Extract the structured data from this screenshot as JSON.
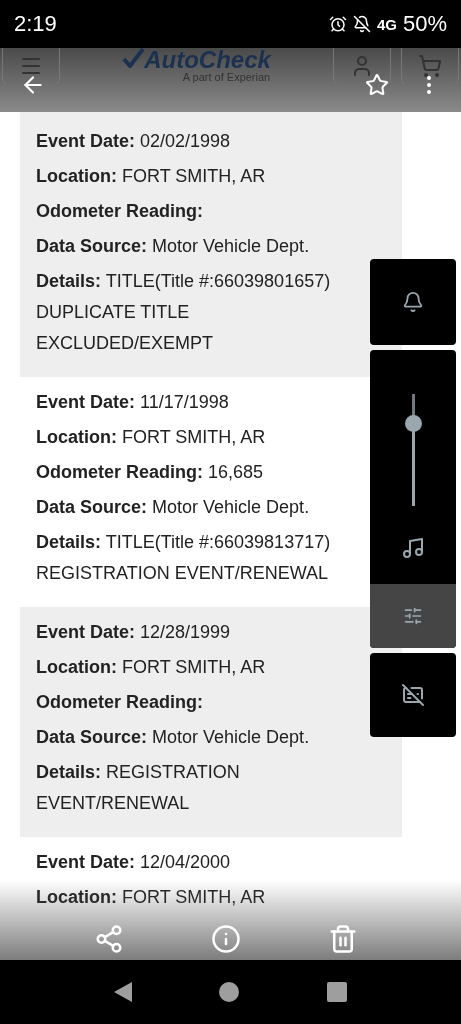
{
  "status_bar": {
    "time": "2:19",
    "network": "4G",
    "battery": "50%"
  },
  "site_header": {
    "brand": "AutoCheck",
    "tagline": "A part of Experian"
  },
  "records": [
    {
      "fields": [
        {
          "label": "Event Date:",
          "value": "02/02/1998"
        },
        {
          "label": "Location:",
          "value": "FORT SMITH, AR"
        },
        {
          "label": "Odometer Reading:"
        },
        {
          "label": "Data Source:",
          "value": "Motor Vehicle Dept."
        },
        {
          "label": "Details:",
          "value": "TITLE(Title #:66039801657) DUPLICATE TITLE EXCLUDED/EXEMPT"
        }
      ]
    },
    {
      "fields": [
        {
          "label": "Event Date:",
          "value": "11/17/1998"
        },
        {
          "label": "Location:",
          "value": "FORT SMITH, AR"
        },
        {
          "label": "Odometer Reading:",
          "value": "16,685"
        },
        {
          "label": "Data Source:",
          "value": "Motor Vehicle Dept."
        },
        {
          "label": "Details:",
          "value": "TITLE(Title #:66039813717) REGISTRATION EVENT/RENEWAL"
        }
      ]
    },
    {
      "fields": [
        {
          "label": "Event Date:",
          "value": "12/28/1999"
        },
        {
          "label": "Location:",
          "value": "FORT SMITH, AR"
        },
        {
          "label": "Odometer Reading:"
        },
        {
          "label": "Data Source:",
          "value": "Motor Vehicle Dept."
        },
        {
          "label": "Details:",
          "value": "REGISTRATION EVENT/RENEWAL"
        }
      ]
    },
    {
      "fields": [
        {
          "label": "Event Date:",
          "value": "12/04/2000"
        },
        {
          "label": "Location:",
          "value": "FORT SMITH, AR"
        }
      ]
    }
  ],
  "volume_panel": {
    "level": 0.73
  }
}
